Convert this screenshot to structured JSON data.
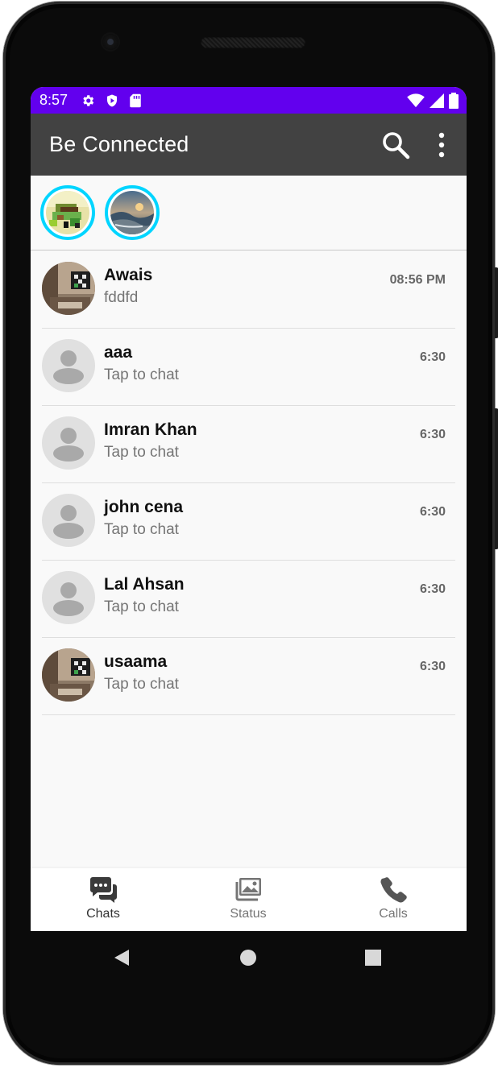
{
  "status_bar": {
    "time": "8:57",
    "left_icons": [
      "gear-icon",
      "shield-icon",
      "sd-card-icon"
    ],
    "right_icons": [
      "wifi-icon",
      "signal-icon",
      "battery-icon"
    ],
    "color": "#6200ee"
  },
  "toolbar": {
    "title": "Be Connected",
    "search_icon": "search-icon",
    "menu_icon": "more-vert-icon",
    "color": "#424242"
  },
  "stories": {
    "ring_color": "#00d5ff",
    "items": [
      {
        "icon": "pixel-art-story-thumbnail"
      },
      {
        "icon": "landscape-story-thumbnail"
      }
    ]
  },
  "chats": [
    {
      "name": "Awais",
      "message": "fddfd",
      "time": "08:56 PM",
      "avatar": "photo"
    },
    {
      "name": "aaa",
      "message": "Tap to chat",
      "time": "6:30",
      "avatar": "default"
    },
    {
      "name": "Imran Khan",
      "message": "Tap to chat",
      "time": "6:30",
      "avatar": "default"
    },
    {
      "name": "john cena",
      "message": "Tap to chat",
      "time": "6:30",
      "avatar": "default"
    },
    {
      "name": "Lal Ahsan",
      "message": "Tap to chat",
      "time": "6:30",
      "avatar": "default"
    },
    {
      "name": "usaama",
      "message": "Tap to chat",
      "time": "6:30",
      "avatar": "photo"
    }
  ],
  "bottom_nav": {
    "items": [
      {
        "label": "Chats",
        "icon": "chat-bubbles-icon",
        "active": true
      },
      {
        "label": "Status",
        "icon": "photos-icon",
        "active": false
      },
      {
        "label": "Calls",
        "icon": "phone-icon",
        "active": false
      }
    ]
  },
  "system_nav": {
    "icons": [
      "back-icon",
      "home-icon",
      "recents-icon"
    ]
  }
}
